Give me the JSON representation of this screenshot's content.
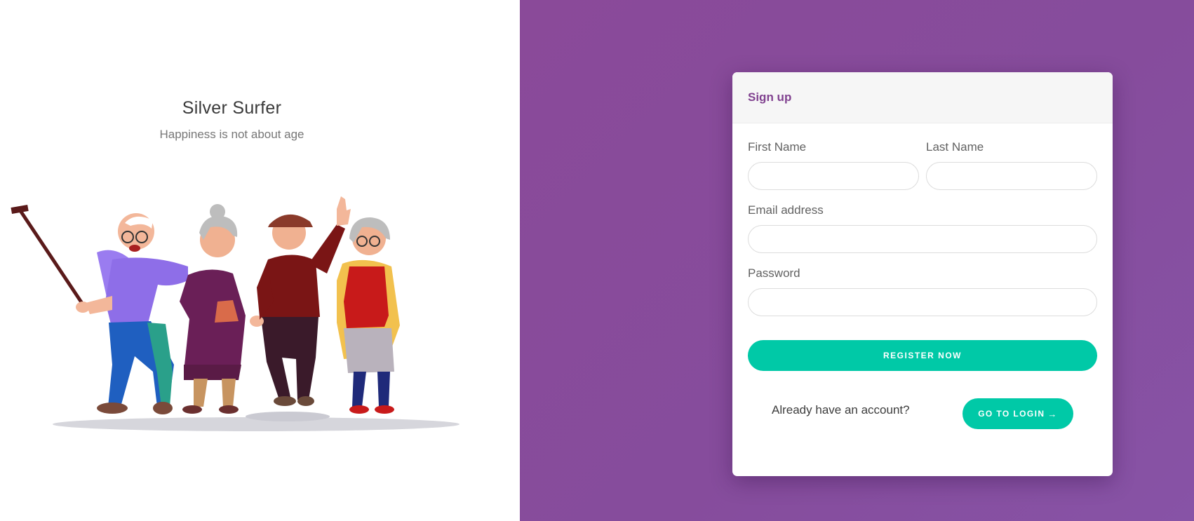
{
  "brand": {
    "title": "Silver Surfer",
    "tagline": "Happiness is not about age"
  },
  "illustration": {
    "icon": "seniors-selfie-illustration"
  },
  "signup": {
    "header": "Sign up",
    "fields": {
      "first_name": {
        "label": "First Name",
        "value": "",
        "placeholder": ""
      },
      "last_name": {
        "label": "Last Name",
        "value": "",
        "placeholder": ""
      },
      "email": {
        "label": "Email address",
        "value": "",
        "placeholder": ""
      },
      "password": {
        "label": "Password",
        "value": "",
        "placeholder": ""
      }
    },
    "register_label": "REGISTER NOW",
    "already_text": "Already have an account?",
    "login_label": "GO TO LOGIN",
    "login_icon": "arrow-right-icon"
  },
  "colors": {
    "accent": "#00c9a7",
    "brand_purple": "#80418f",
    "background_purple": "#864c9c"
  }
}
